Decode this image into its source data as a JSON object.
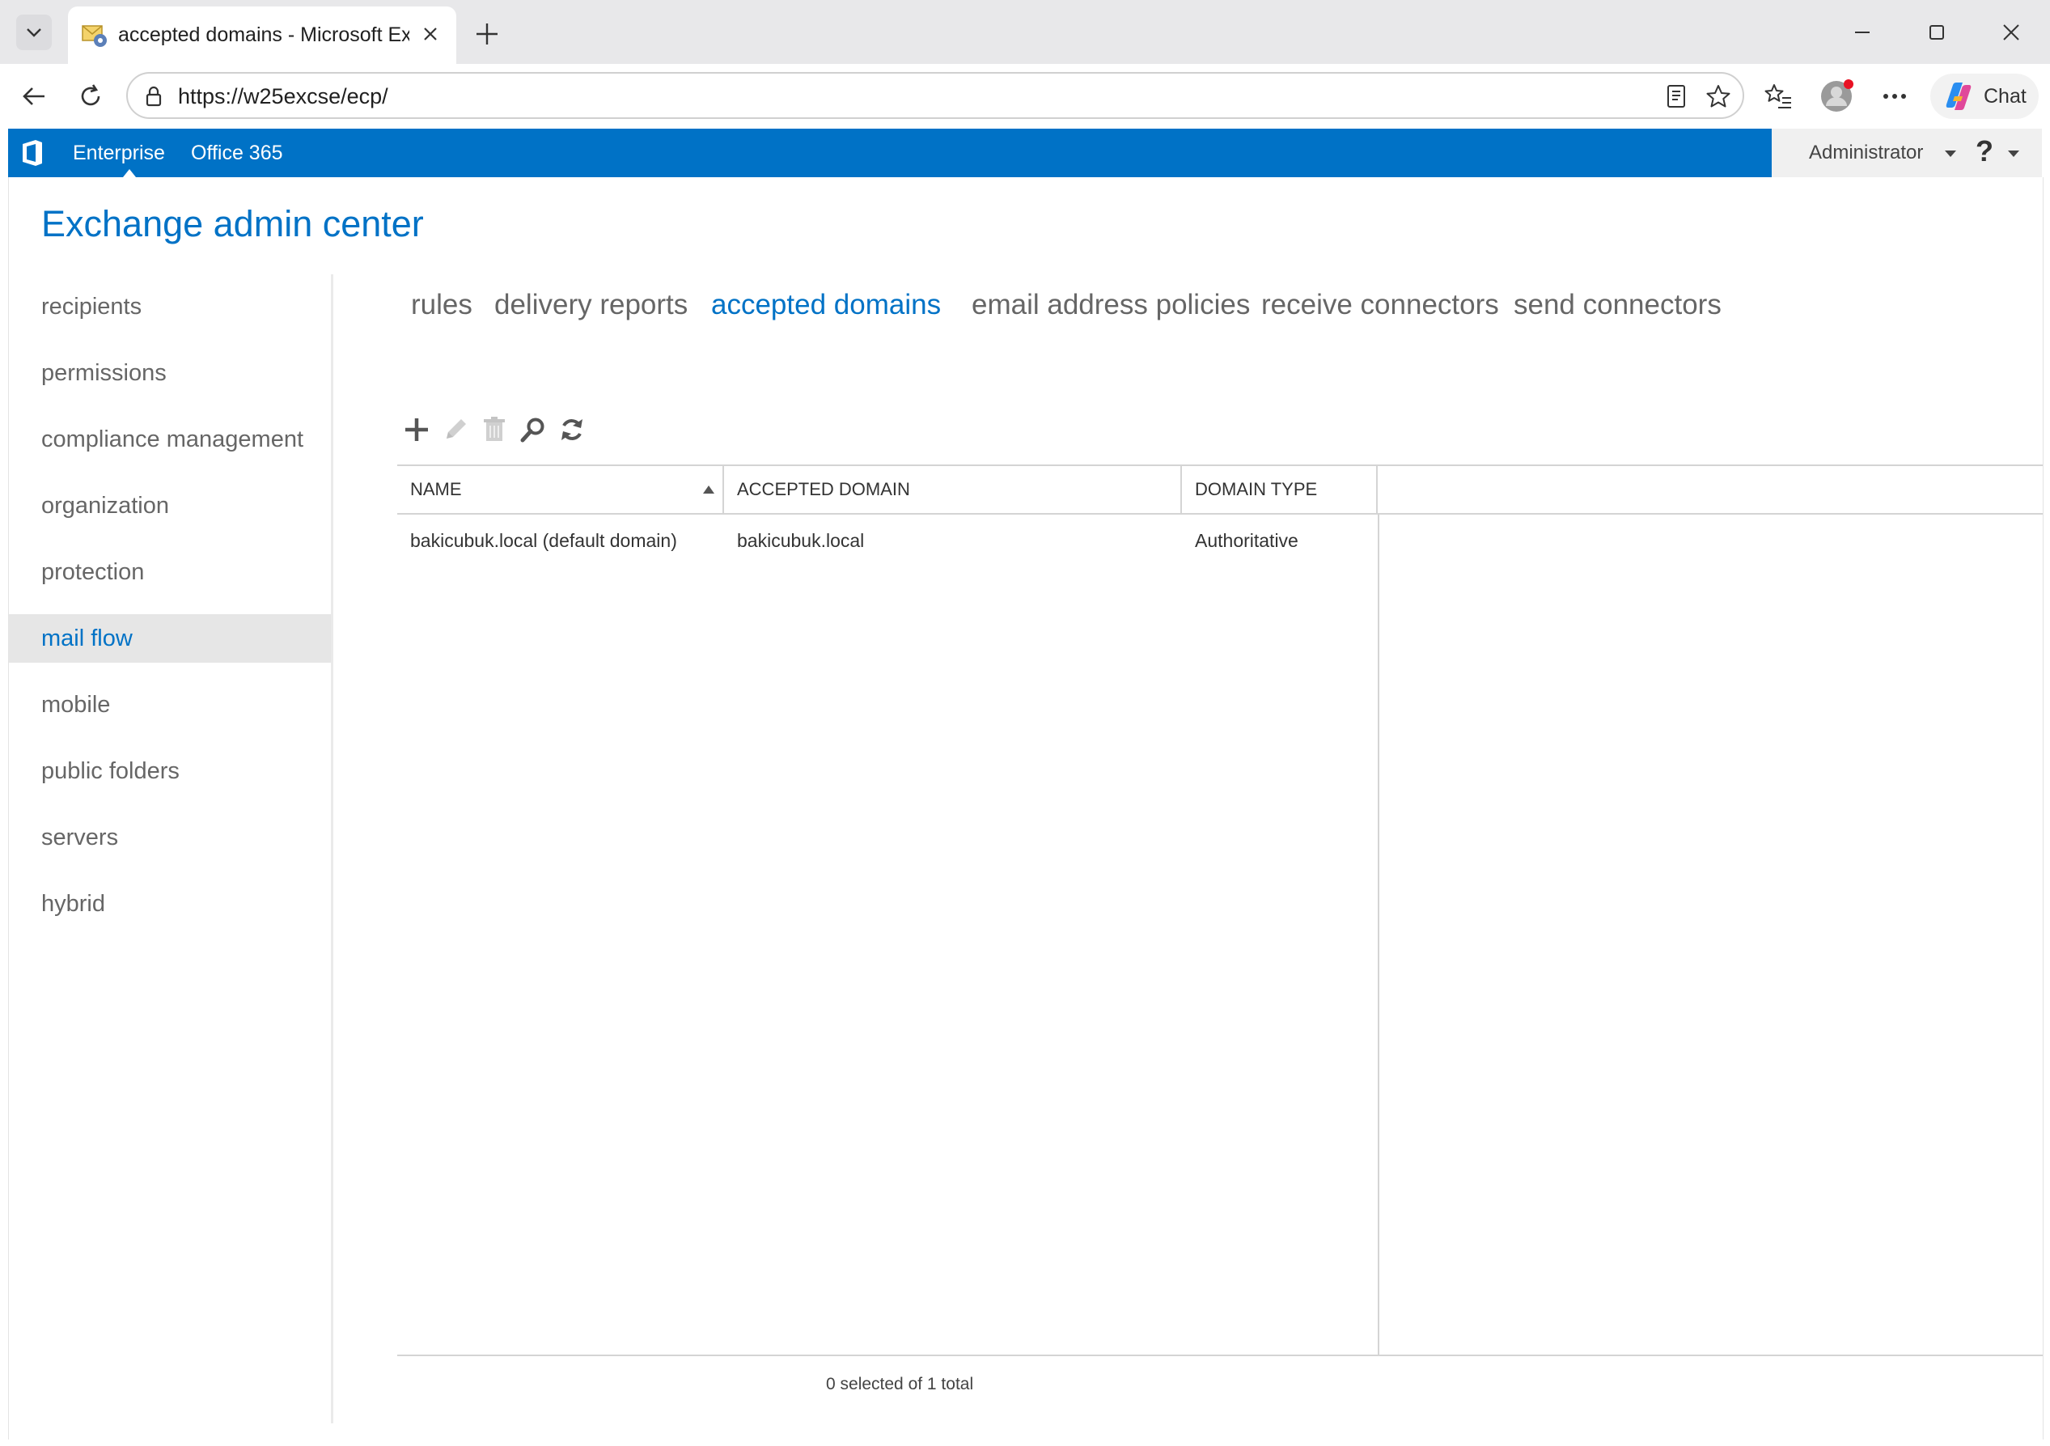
{
  "browser": {
    "tab_title": "accepted domains - Microsoft Exchange",
    "url": "https://w25excse/ecp/",
    "chat_label": "Chat"
  },
  "o365_bar": {
    "links": [
      "Enterprise",
      "Office 365"
    ],
    "user": "Administrator",
    "help": "?"
  },
  "app": {
    "title": "Exchange admin center"
  },
  "nav": {
    "items": [
      {
        "label": "recipients"
      },
      {
        "label": "permissions"
      },
      {
        "label": "compliance management"
      },
      {
        "label": "organization"
      },
      {
        "label": "protection"
      },
      {
        "label": "mail flow",
        "active": true
      },
      {
        "label": "mobile"
      },
      {
        "label": "public folders"
      },
      {
        "label": "servers"
      },
      {
        "label": "hybrid"
      }
    ]
  },
  "subtabs": [
    {
      "label": "rules"
    },
    {
      "label": "delivery reports"
    },
    {
      "label": "accepted domains",
      "active": true
    },
    {
      "label": "email address policies"
    },
    {
      "label": "receive connectors"
    },
    {
      "label": "send connectors"
    }
  ],
  "grid": {
    "columns": [
      "NAME",
      "ACCEPTED DOMAIN",
      "DOMAIN TYPE"
    ],
    "rows": [
      [
        "bakicubuk.local (default domain)",
        "bakicubuk.local",
        "Authoritative"
      ]
    ],
    "status": "0 selected of 1 total"
  },
  "colors": {
    "accent": "#0072c6",
    "nav_active_bg": "#e6e6e6"
  }
}
